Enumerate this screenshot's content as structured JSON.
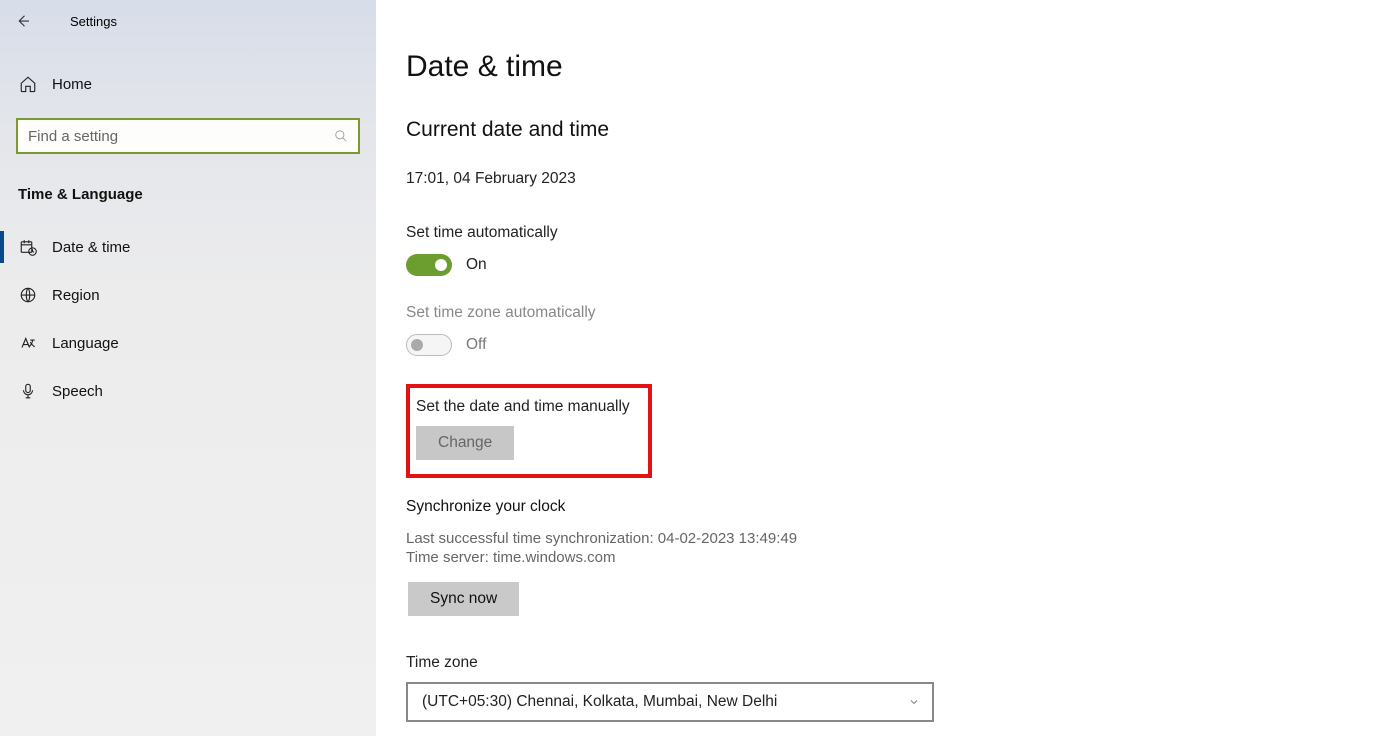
{
  "header": {
    "app_title": "Settings"
  },
  "sidebar": {
    "home": "Home",
    "search_placeholder": "Find a setting",
    "section": "Time & Language",
    "items": [
      {
        "icon": "calendar-clock-icon",
        "label": "Date & time",
        "active": true
      },
      {
        "icon": "globe-icon",
        "label": "Region",
        "active": false
      },
      {
        "icon": "language-icon",
        "label": "Language",
        "active": false
      },
      {
        "icon": "mic-icon",
        "label": "Speech",
        "active": false
      }
    ]
  },
  "main": {
    "title": "Date & time",
    "current_heading": "Current date and time",
    "current_value": "17:01, 04 February 2023",
    "set_time_auto_label": "Set time automatically",
    "set_time_auto_state": "On",
    "set_tz_auto_label": "Set time zone automatically",
    "set_tz_auto_state": "Off",
    "set_manual_label": "Set the date and time manually",
    "change_button": "Change",
    "sync_heading": "Synchronize your clock",
    "sync_last": "Last successful time synchronization: 04-02-2023 13:49:49",
    "sync_server": "Time server: time.windows.com",
    "sync_button": "Sync now",
    "tz_label": "Time zone",
    "tz_value": "(UTC+05:30) Chennai, Kolkata, Mumbai, New Delhi"
  }
}
